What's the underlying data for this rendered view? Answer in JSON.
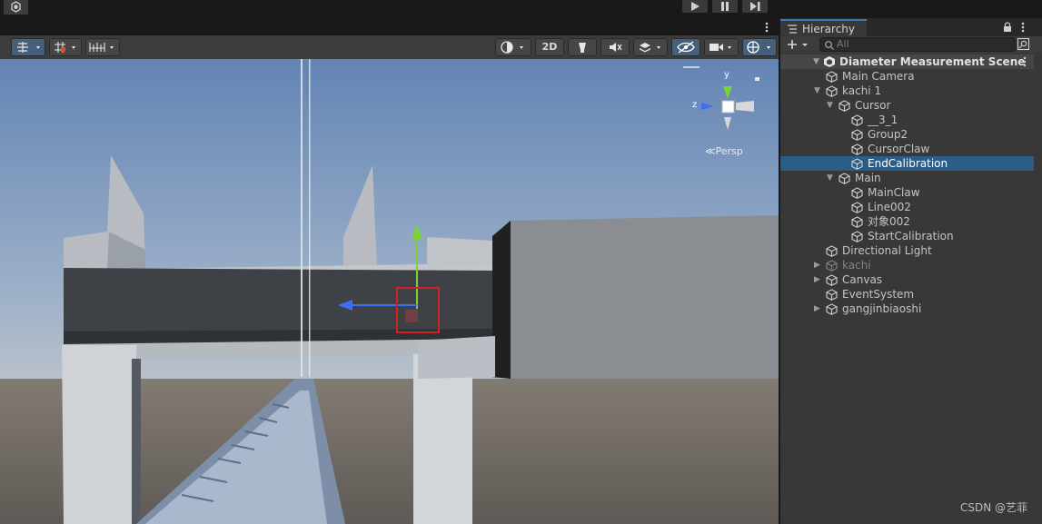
{
  "scene_view": {
    "toolbar": {
      "mode_2d_label": "2D"
    },
    "gizmo": {
      "axis_y": "y",
      "axis_z": "z",
      "projection_label": "Persp"
    }
  },
  "hierarchy": {
    "tab_title": "Hierarchy",
    "search_placeholder": "All",
    "scene_name": "Diameter Measurement Scene",
    "items": [
      {
        "label": "Main Camera",
        "depth": 1,
        "expand": "none",
        "selected": false,
        "dimmed": false
      },
      {
        "label": "kachi 1",
        "depth": 1,
        "expand": "expanded",
        "selected": false,
        "dimmed": false
      },
      {
        "label": "Cursor",
        "depth": 2,
        "expand": "expanded",
        "selected": false,
        "dimmed": false
      },
      {
        "label": "__3_1",
        "depth": 3,
        "expand": "none",
        "selected": false,
        "dimmed": false
      },
      {
        "label": "Group2",
        "depth": 3,
        "expand": "none",
        "selected": false,
        "dimmed": false
      },
      {
        "label": "CursorClaw",
        "depth": 3,
        "expand": "none",
        "selected": false,
        "dimmed": false
      },
      {
        "label": "EndCalibration",
        "depth": 3,
        "expand": "none",
        "selected": true,
        "dimmed": false
      },
      {
        "label": "Main",
        "depth": 2,
        "expand": "expanded",
        "selected": false,
        "dimmed": false
      },
      {
        "label": "MainClaw",
        "depth": 3,
        "expand": "none",
        "selected": false,
        "dimmed": false
      },
      {
        "label": "Line002",
        "depth": 3,
        "expand": "none",
        "selected": false,
        "dimmed": false
      },
      {
        "label": "对象002",
        "depth": 3,
        "expand": "none",
        "selected": false,
        "dimmed": false
      },
      {
        "label": "StartCalibration",
        "depth": 3,
        "expand": "none",
        "selected": false,
        "dimmed": false
      },
      {
        "label": "Directional Light",
        "depth": 1,
        "expand": "none",
        "selected": false,
        "dimmed": false
      },
      {
        "label": "kachi",
        "depth": 1,
        "expand": "collapsed",
        "selected": false,
        "dimmed": true
      },
      {
        "label": "Canvas",
        "depth": 1,
        "expand": "collapsed",
        "selected": false,
        "dimmed": false
      },
      {
        "label": "EventSystem",
        "depth": 1,
        "expand": "none",
        "selected": false,
        "dimmed": false
      },
      {
        "label": "gangjinbiaoshi",
        "depth": 1,
        "expand": "collapsed",
        "selected": false,
        "dimmed": false
      }
    ]
  },
  "watermark": "CSDN @艺菲",
  "colors": {
    "selection": "#2c5d87",
    "panel_bg": "#383838",
    "gizmo_y": "#7ad13a",
    "gizmo_z": "#3d6ff2",
    "selection_box": "#d42020"
  }
}
